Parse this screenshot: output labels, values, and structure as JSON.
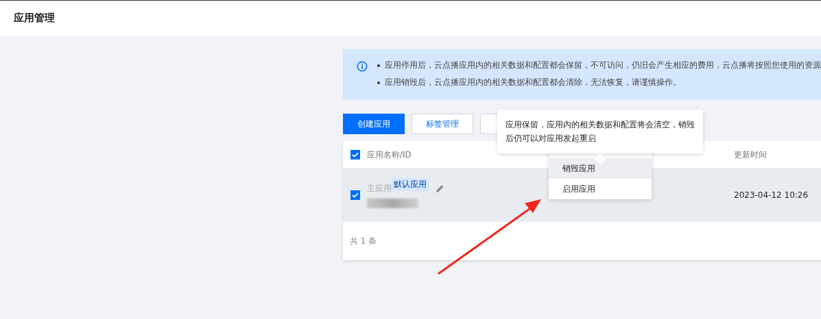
{
  "header": {
    "title": "应用管理"
  },
  "notice": {
    "items": [
      "应用停用后，云点播应用内的相关数据和配置都会保留，不可访问，仍旧会产生相应的费用，云点播将按照您使用的资源",
      "应用销毁后，云点播应用内的相关数据和配置都会清除，无法恢复，请谨慎操作。"
    ]
  },
  "toolbar": {
    "buttons": [
      {
        "label": "创建应用",
        "kind": "primary"
      },
      {
        "label": "标签管理",
        "kind": "default"
      }
    ]
  },
  "table": {
    "select_all_checked": true,
    "columns": [
      "应用名称/ID",
      "更新时间"
    ],
    "rows": [
      {
        "selected": true,
        "checked": true,
        "name": "主应用",
        "tag": "默认应用",
        "updated": "2023-04-12 10:26"
      }
    ],
    "footer": "共 1 条"
  },
  "tooltip": {
    "text": "应用保留，应用内的相关数据和配置将会清空，销毁后仍可以对应用发起重启"
  },
  "menu": {
    "items": [
      {
        "label": "销毁应用",
        "highlighted": true
      },
      {
        "label": "启用应用",
        "highlighted": false
      }
    ]
  }
}
